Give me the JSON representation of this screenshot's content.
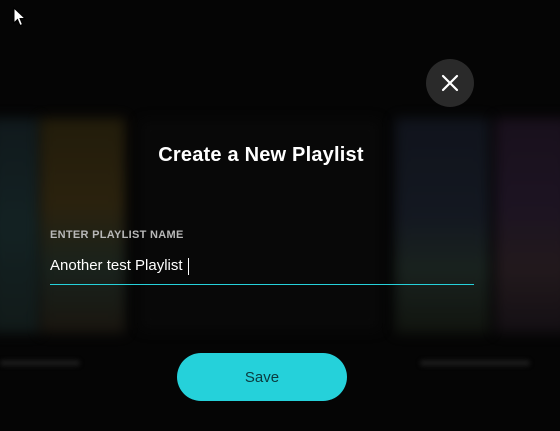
{
  "dialog": {
    "title": "Create a New Playlist",
    "field_label": "ENTER PLAYLIST NAME",
    "field_value": "Another test Playlist",
    "save_label": "Save",
    "close_icon": "close-icon"
  },
  "colors": {
    "accent": "#25d1da",
    "background": "#050505",
    "close_bg": "#2a2a2a",
    "title": "#ffffff",
    "label": "#b8b8b8"
  }
}
